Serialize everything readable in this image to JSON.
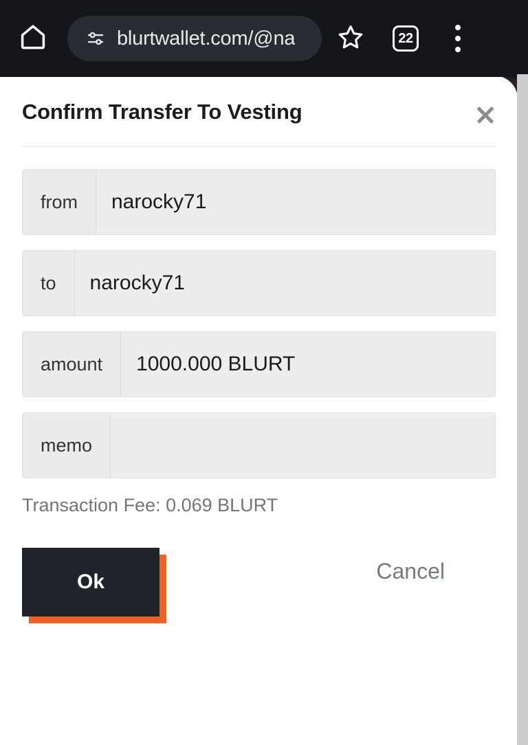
{
  "browser": {
    "home_icon": "home-icon",
    "url_icon": "tune-icon",
    "url": "blurtwallet.com/@na",
    "bookmark_icon": "star-icon",
    "tab_count": "22",
    "menu_icon": "overflow-menu-icon"
  },
  "dialog": {
    "title": "Confirm Transfer To Vesting",
    "close_icon": "close-icon",
    "fields": [
      {
        "label": "from",
        "value": "narocky71"
      },
      {
        "label": "to",
        "value": "narocky71"
      },
      {
        "label": "amount",
        "value": "1000.000 BLURT"
      },
      {
        "label": "memo",
        "value": ""
      }
    ],
    "fee_text": "Transaction Fee: 0.069 BLURT",
    "confirm_label": "Ok",
    "cancel_label": "Cancel"
  },
  "colors": {
    "accent_orange": "#f06128",
    "button_dark": "#1f242b",
    "chrome_dark": "#141619",
    "field_gray": "#ededed"
  }
}
